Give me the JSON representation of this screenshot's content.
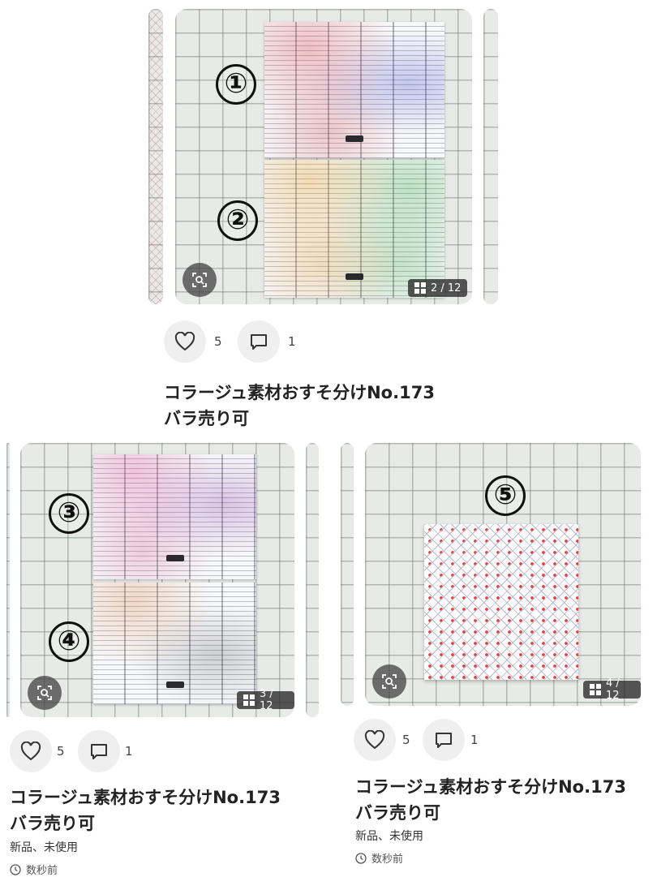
{
  "feed": {
    "items": [
      {
        "labels": [
          "①",
          "②"
        ],
        "image_counter": "2 / 12",
        "likes": "5",
        "comments": "1",
        "title_line1": "コラージュ素材おすそ分けNo.173",
        "title_line2": "バラ売り可"
      },
      {
        "labels": [
          "③",
          "④"
        ],
        "image_counter": "3 / 12",
        "likes": "5",
        "comments": "1",
        "title_line1": "コラージュ素材おすそ分けNo.173",
        "title_line2": "バラ売り可",
        "condition": "新品、未使用",
        "time": "数秒前"
      },
      {
        "labels": [
          "⑤"
        ],
        "image_counter": "4 / 12",
        "likes": "5",
        "comments": "1",
        "title_line1": "コラージュ素材おすそ分けNo.173",
        "title_line2": "バラ売り可",
        "condition": "新品、未使用",
        "time": "数秒前"
      }
    ]
  },
  "colors": {
    "grid_background": "#e7eae6",
    "pattern_dots": "#e0413d",
    "overlay": "#464646"
  }
}
